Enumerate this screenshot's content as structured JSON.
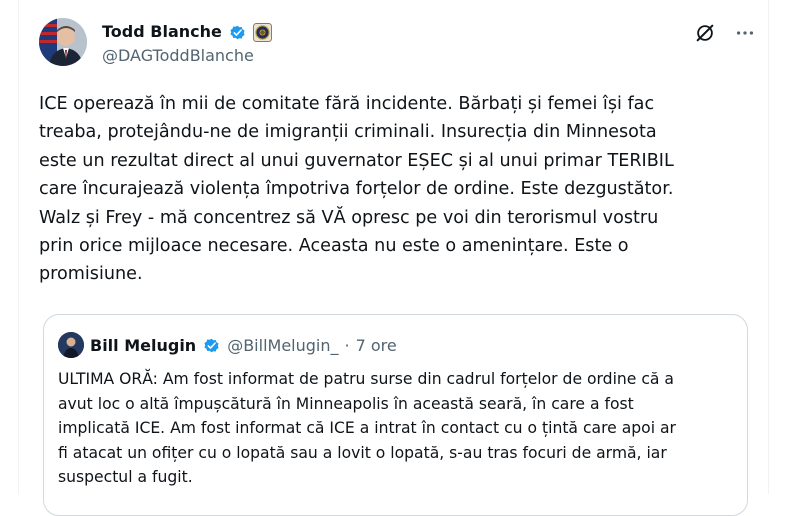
{
  "author": {
    "name": "Todd Blanche",
    "handle": "@DAGToddBlanche"
  },
  "post": {
    "text": "ICE operează în mii de comitate fără incidente. Bărbați și femei își fac\ntreaba, protejându-ne de imigranții criminali. Insurecția din Minnesota\neste un rezultat direct al unui guvernator EȘEC și al unui primar TERIBIL\ncare încurajează violența împotriva forțelor de ordine. Este dezgustător.\nWalz și Frey - mă concentrez să VĂ opresc pe voi din terorismul vostru\nprin orice mijloace necesare. Aceasta nu este o amenințare. Este o\npromisiune."
  },
  "quote": {
    "name": "Bill Melugin",
    "handle": "@BillMelugin_",
    "separator": "·",
    "time": "7 ore",
    "text": "ULTIMA ORĂ: Am fost informat de patru surse din cadrul forțelor de ordine că a\navut loc o altă împușcătură în Minneapolis în această seară, în care a fost\nimplicată ICE. Am fost informat că ICE a intrat în contact cu o țintă care apoi ar\nfi atacat un ofițer cu o lopată sau a lovit o lopată, s-au tras focuri de armă, iar\nsuspectul a fugit."
  },
  "icons": {
    "verified": "verified-badge-icon",
    "seal": "government-seal-icon",
    "grok": "grok-icon",
    "more": "more-icon"
  },
  "colors": {
    "verified_blue": "#1d9bf0",
    "text": "#0f1419",
    "secondary": "#536471",
    "border": "#cfd9de"
  }
}
